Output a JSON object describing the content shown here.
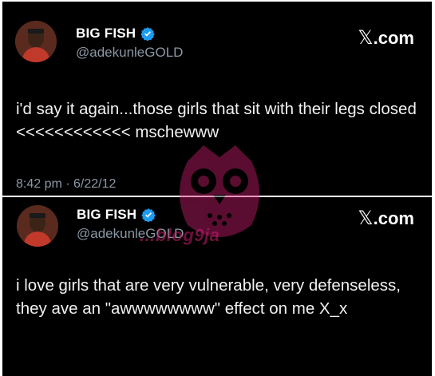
{
  "tweets": [
    {
      "display_name": "BIG FISH",
      "handle": "@adekunleGOLD",
      "brand_x": "𝕏",
      "brand_suffix": ".com",
      "text": "i'd say it again...those girls that sit with their legs closed <<<<<<<<<<<< mschewww",
      "timestamp": "8:42 pm · 6/22/12"
    },
    {
      "display_name": "BIG FISH",
      "handle": "@adekunleGOLD",
      "brand_x": "𝕏",
      "brand_suffix": ".com",
      "text": "i love girls that are very vulnerable, very defenseless, they ave an \"awwwwwwww\" effect on me X_x"
    }
  ],
  "watermark": {
    "text": "...blog9ja"
  },
  "colors": {
    "background": "#000000",
    "verified": "#1d9bf0",
    "secondary_text": "#8b98a5",
    "watermark": "#c81e6e"
  },
  "icons": {
    "verified": "verified-badge-icon",
    "watermark_logo": "owl-logo-icon"
  }
}
